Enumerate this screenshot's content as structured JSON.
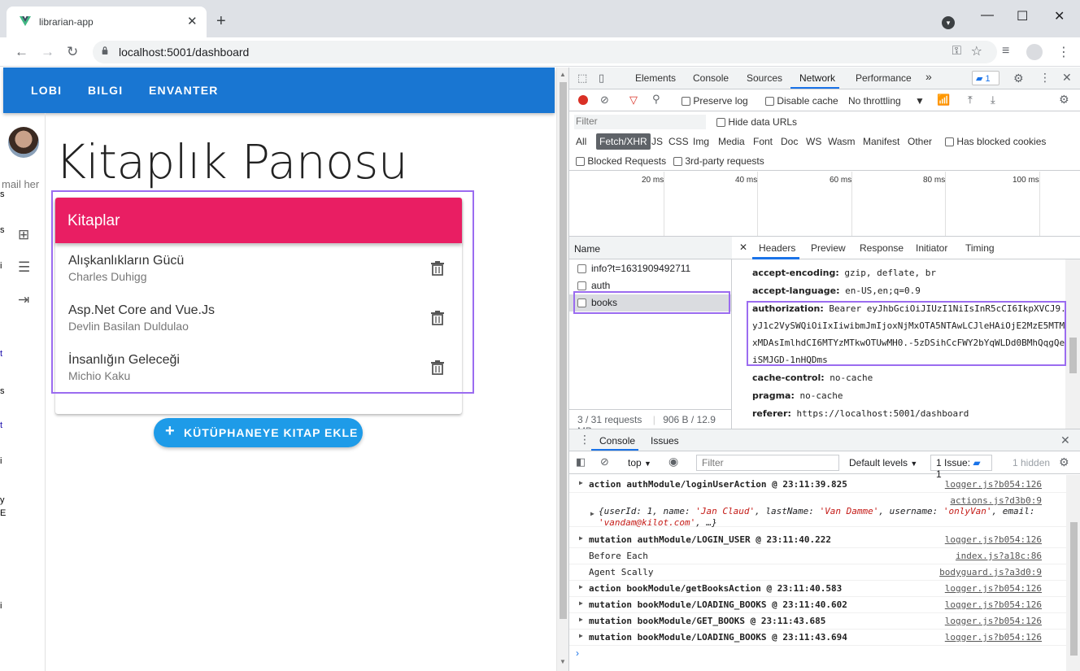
{
  "browser": {
    "tab_title": "librarian-app",
    "tab_close": "✕",
    "new_tab": "+",
    "url": "localhost:5001/dashboard",
    "window_controls": {
      "minimize": "—",
      "maximize": "☐",
      "close": "✕"
    }
  },
  "app": {
    "nav": [
      "LOBI",
      "BILGI",
      "ENVANTER"
    ],
    "sidebar_email": "mail her",
    "edge_fragments": [
      "s",
      "s",
      "i",
      "t",
      "t",
      "s",
      "t",
      "i",
      "y",
      "E",
      "i"
    ],
    "title": "Kitaplık Panosu",
    "card_title": "Kitaplar",
    "books": [
      {
        "title": "Alışkanlıkların Gücü",
        "author": "Charles Duhigg"
      },
      {
        "title": "Asp.Net Core and Vue.Js",
        "author": "Devlin Basilan Duldulao"
      },
      {
        "title": "İnsanlığın Geleceği",
        "author": "Michio Kaku"
      }
    ],
    "add_button": "KÜTÜPHANEYE KITAP EKLE",
    "add_icon": "+"
  },
  "devtools": {
    "tabs": [
      "Elements",
      "Console",
      "Sources",
      "Network",
      "Performance"
    ],
    "more_tabs": "»",
    "issue_count": "1",
    "network": {
      "preserve_log": "Preserve log",
      "disable_cache": "Disable cache",
      "throttling": "No throttling",
      "filter_placeholder": "Filter",
      "hide_data_urls": "Hide data URLs",
      "types": [
        "All",
        "Fetch/XHR",
        "JS",
        "CSS",
        "Img",
        "Media",
        "Font",
        "Doc",
        "WS",
        "Wasm",
        "Manifest",
        "Other"
      ],
      "has_blocked_cookies": "Has blocked cookies",
      "blocked_requests": "Blocked Requests",
      "third_party": "3rd-party requests",
      "timeline_labels": [
        "20 ms",
        "40 ms",
        "60 ms",
        "80 ms",
        "100 ms"
      ],
      "name_header": "Name",
      "requests": [
        "info?t=1631909492711",
        "auth",
        "books"
      ],
      "footer_requests": "3 / 31 requests",
      "footer_size": "906 B / 12.9 MB",
      "detail_tabs": [
        "Headers",
        "Preview",
        "Response",
        "Initiator",
        "Timing"
      ],
      "headers": [
        {
          "name": "accept-encoding:",
          "value": "gzip, deflate, br"
        },
        {
          "name": "accept-language:",
          "value": "en-US,en;q=0.9"
        },
        {
          "name": "authorization:",
          "value": "Bearer eyJhbGciOiJIUzI1NiIsInR5cCI6IkpXVCJ9.e"
        },
        {
          "name": "",
          "value": "yJ1c2VySWQiOiIxIiwibmJmIjoxNjMxOTA5NTAwLCJleHAiOjE2MzE5MTM"
        },
        {
          "name": "",
          "value": "xMDAsImlhdCI6MTYzMTkwOTUwMH0.-5zDSihCcFWY2bYqWLDd0BMhQqgQe"
        },
        {
          "name": "",
          "value": "iSMJGD-1nHQDms"
        },
        {
          "name": "cache-control:",
          "value": "no-cache"
        },
        {
          "name": "pragma:",
          "value": "no-cache"
        },
        {
          "name": "referer:",
          "value": "https://localhost:5001/dashboard"
        }
      ]
    },
    "console": {
      "tabs": [
        "Console",
        "Issues"
      ],
      "context": "top",
      "filter_placeholder": "Filter",
      "levels": "Default levels",
      "issues_label": "1 Issue:",
      "issues_count": "1",
      "hidden": "1 hidden",
      "logs": [
        {
          "msg": "action authModule/loginUserAction @ 23:11:39.825",
          "src": "logger.js?b054:126"
        },
        {
          "msg": "",
          "src": "actions.js?d3b0:9"
        },
        {
          "msg": "mutation authModule/LOGIN_USER @ 23:11:40.222",
          "src": "logger.js?b054:126"
        },
        {
          "msg": "Before Each",
          "src": "index.js?a18c:86"
        },
        {
          "msg": "Agent Scally",
          "src": "bodyguard.js?a3d0:9"
        },
        {
          "msg": "action bookModule/getBooksAction @ 23:11:40.583",
          "src": "logger.js?b054:126"
        },
        {
          "msg": "mutation bookModule/LOADING_BOOKS @ 23:11:40.602",
          "src": "logger.js?b054:126"
        },
        {
          "msg": "mutation bookModule/GET_BOOKS @ 23:11:43.685",
          "src": "logger.js?b054:126"
        },
        {
          "msg": "mutation bookModule/LOADING_BOOKS @ 23:11:43.694",
          "src": "logger.js?b054:126"
        }
      ],
      "object_line1_prefix": "{userId: 1, name: ",
      "object_name": "'Jan Claud'",
      "object_mid1": ", lastName: ",
      "object_lastname": "'Van Damme'",
      "object_mid2": ", username: ",
      "object_username": "'onlyVan'",
      "object_mid3": ", email:",
      "object_email": "'vandam@kilot.com'",
      "object_end": ", …}",
      "prompt": "›"
    }
  },
  "colors": {
    "appbar": "#1976d2",
    "card_header": "#e91e63",
    "add_button": "#1e9be8",
    "highlight": "#9b6cf0",
    "devtools_accent": "#1a73e8"
  }
}
